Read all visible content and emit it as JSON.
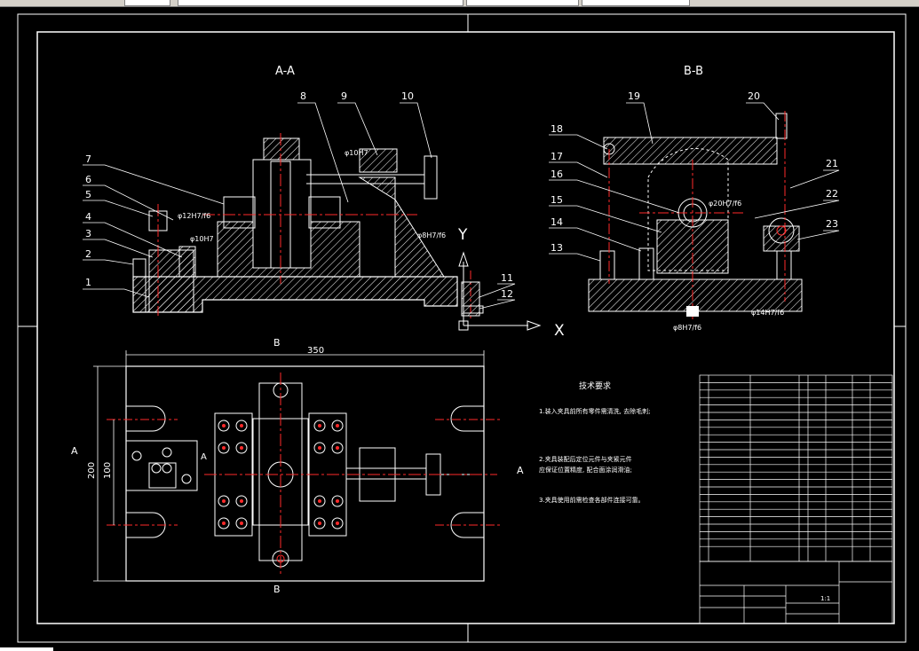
{
  "views": {
    "section_aa": "A-A",
    "section_bb": "B-B"
  },
  "part_numbers_aa": [
    "1",
    "2",
    "3",
    "4",
    "5",
    "6",
    "7",
    "8",
    "9",
    "10",
    "11",
    "12"
  ],
  "part_numbers_bb": [
    "13",
    "14",
    "15",
    "16",
    "17",
    "18",
    "19",
    "20",
    "21",
    "22",
    "23"
  ],
  "fits": {
    "fit_a": "φ12H7/f6",
    "fit_b": "φ10H7",
    "fit_c": "φ8H7/f6",
    "fit_d": "φ20H7/f6",
    "fit_e": "φ14H7/f6"
  },
  "axes": {
    "y": "Y",
    "x": "X"
  },
  "dimensions": {
    "length": "350",
    "height": "200",
    "inner_height": "100"
  },
  "section_marks": {
    "a_left": "A",
    "a_right": "A",
    "b_top": "B",
    "b_bottom": "B",
    "a_mid": "A"
  },
  "technical_requirements": {
    "title": "技术要求",
    "lines": [
      "1.装入夹具前所有零件需清洗, 去除毛刺;",
      "2.夹具装配后定位元件与夹紧元件",
      "  应保证位置精度, 配合面涂润滑油;",
      "3.夹具使用前需检查各部件连接可靠。"
    ]
  },
  "status": {
    "scale_note": "1:1"
  },
  "colors": {
    "background": "#000000",
    "line": "#ffffff",
    "centerline": "#ff2a2a",
    "hatch": "#ffffff",
    "frame": "#ffffff"
  }
}
